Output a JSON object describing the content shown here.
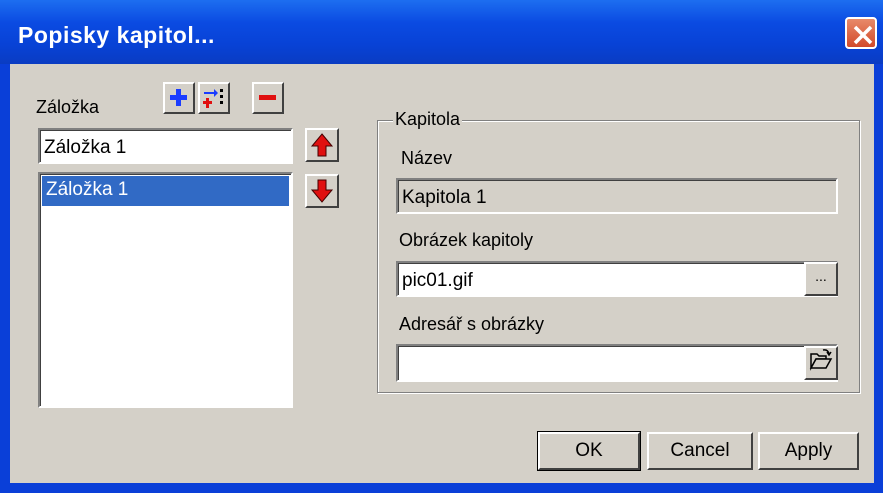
{
  "window": {
    "title": "Popisky kapitol..."
  },
  "left": {
    "bookmark_label": "Záložka",
    "bookmark_value": "Záložka 1",
    "list_items": [
      "Záložka 1"
    ]
  },
  "group": {
    "title": "Kapitola",
    "name_label": "Název",
    "name_value": "Kapitola 1",
    "image_label": "Obrázek kapitoly",
    "image_value": "pic01.gif",
    "browse_label": "...",
    "dir_label": "Adresář s obrázky",
    "dir_value": ""
  },
  "buttons": {
    "ok": "OK",
    "cancel": "Cancel",
    "apply": "Apply"
  },
  "colors": {
    "titlebar": "#0842d6",
    "selection": "#316ac5",
    "face": "#d4d0c8"
  }
}
